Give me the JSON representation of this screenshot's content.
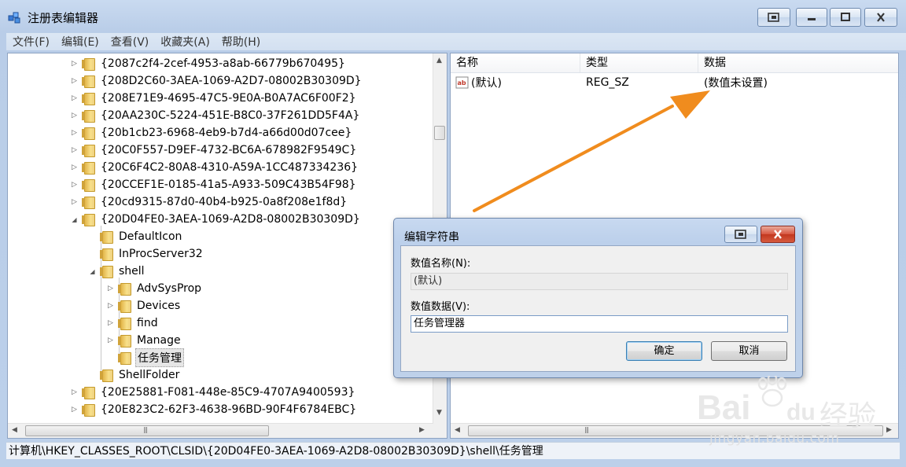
{
  "window": {
    "title": "注册表编辑器"
  },
  "menu": [
    "文件(F)",
    "编辑(E)",
    "查看(V)",
    "收藏夹(A)",
    "帮助(H)"
  ],
  "tree": [
    {
      "label": "{2087c2f4-2cef-4953-a8ab-66779b670495}",
      "level": 0,
      "expander": "collapsed"
    },
    {
      "label": "{208D2C60-3AEA-1069-A2D7-08002B30309D}",
      "level": 0,
      "expander": "collapsed"
    },
    {
      "label": "{208E71E9-4695-47C5-9E0A-B0A7AC6F00F2}",
      "level": 0,
      "expander": "collapsed"
    },
    {
      "label": "{20AA230C-5224-451E-B8C0-37F261DD5F4A}",
      "level": 0,
      "expander": "collapsed"
    },
    {
      "label": "{20b1cb23-6968-4eb9-b7d4-a66d00d07cee}",
      "level": 0,
      "expander": "collapsed"
    },
    {
      "label": "{20C0F557-D9EF-4732-BC6A-678982F9549C}",
      "level": 0,
      "expander": "collapsed"
    },
    {
      "label": "{20C6F4C2-80A8-4310-A59A-1CC487334236}",
      "level": 0,
      "expander": "collapsed"
    },
    {
      "label": "{20CCEF1E-0185-41a5-A933-509C43B54F98}",
      "level": 0,
      "expander": "collapsed"
    },
    {
      "label": "{20cd9315-87d0-40b4-b925-0a8f208e1f8d}",
      "level": 0,
      "expander": "collapsed"
    },
    {
      "label": "{20D04FE0-3AEA-1069-A2D8-08002B30309D}",
      "level": 0,
      "expander": "expanded"
    },
    {
      "label": "DefaultIcon",
      "level": 1,
      "expander": "none"
    },
    {
      "label": "InProcServer32",
      "level": 1,
      "expander": "none"
    },
    {
      "label": "shell",
      "level": 1,
      "expander": "expanded"
    },
    {
      "label": "AdvSysProp",
      "level": 2,
      "expander": "collapsed"
    },
    {
      "label": "Devices",
      "level": 2,
      "expander": "collapsed"
    },
    {
      "label": "find",
      "level": 2,
      "expander": "collapsed"
    },
    {
      "label": "Manage",
      "level": 2,
      "expander": "collapsed"
    },
    {
      "label": "任务管理",
      "level": 2,
      "expander": "none",
      "selected": true
    },
    {
      "label": "ShellFolder",
      "level": 1,
      "expander": "none"
    },
    {
      "label": "{20E25881-F081-448e-85C9-4707A9400593}",
      "level": 0,
      "expander": "collapsed"
    },
    {
      "label": "{20E823C2-62F3-4638-96BD-90F4F6784EBC}",
      "level": 0,
      "expander": "collapsed"
    }
  ],
  "list": {
    "headers": {
      "name": "名称",
      "type": "类型",
      "data": "数据"
    },
    "rows": [
      {
        "name": "(默认)",
        "type": "REG_SZ",
        "data": "(数值未设置)"
      }
    ]
  },
  "statusbar": "计算机\\HKEY_CLASSES_ROOT\\CLSID\\{20D04FE0-3AEA-1069-A2D8-08002B30309D}\\shell\\任务管理",
  "dialog": {
    "title": "编辑字符串",
    "name_label": "数值名称(N):",
    "name_value": "(默认)",
    "data_label": "数值数据(V):",
    "data_value": "任务管理器",
    "ok": "确定",
    "cancel": "取消"
  },
  "annotation": {
    "arrow_color": "#f08c1e"
  },
  "watermark": {
    "brand": "Bai",
    "brand_tail": "du",
    "cn": "经验",
    "url": "jingyan.baidu.com"
  }
}
